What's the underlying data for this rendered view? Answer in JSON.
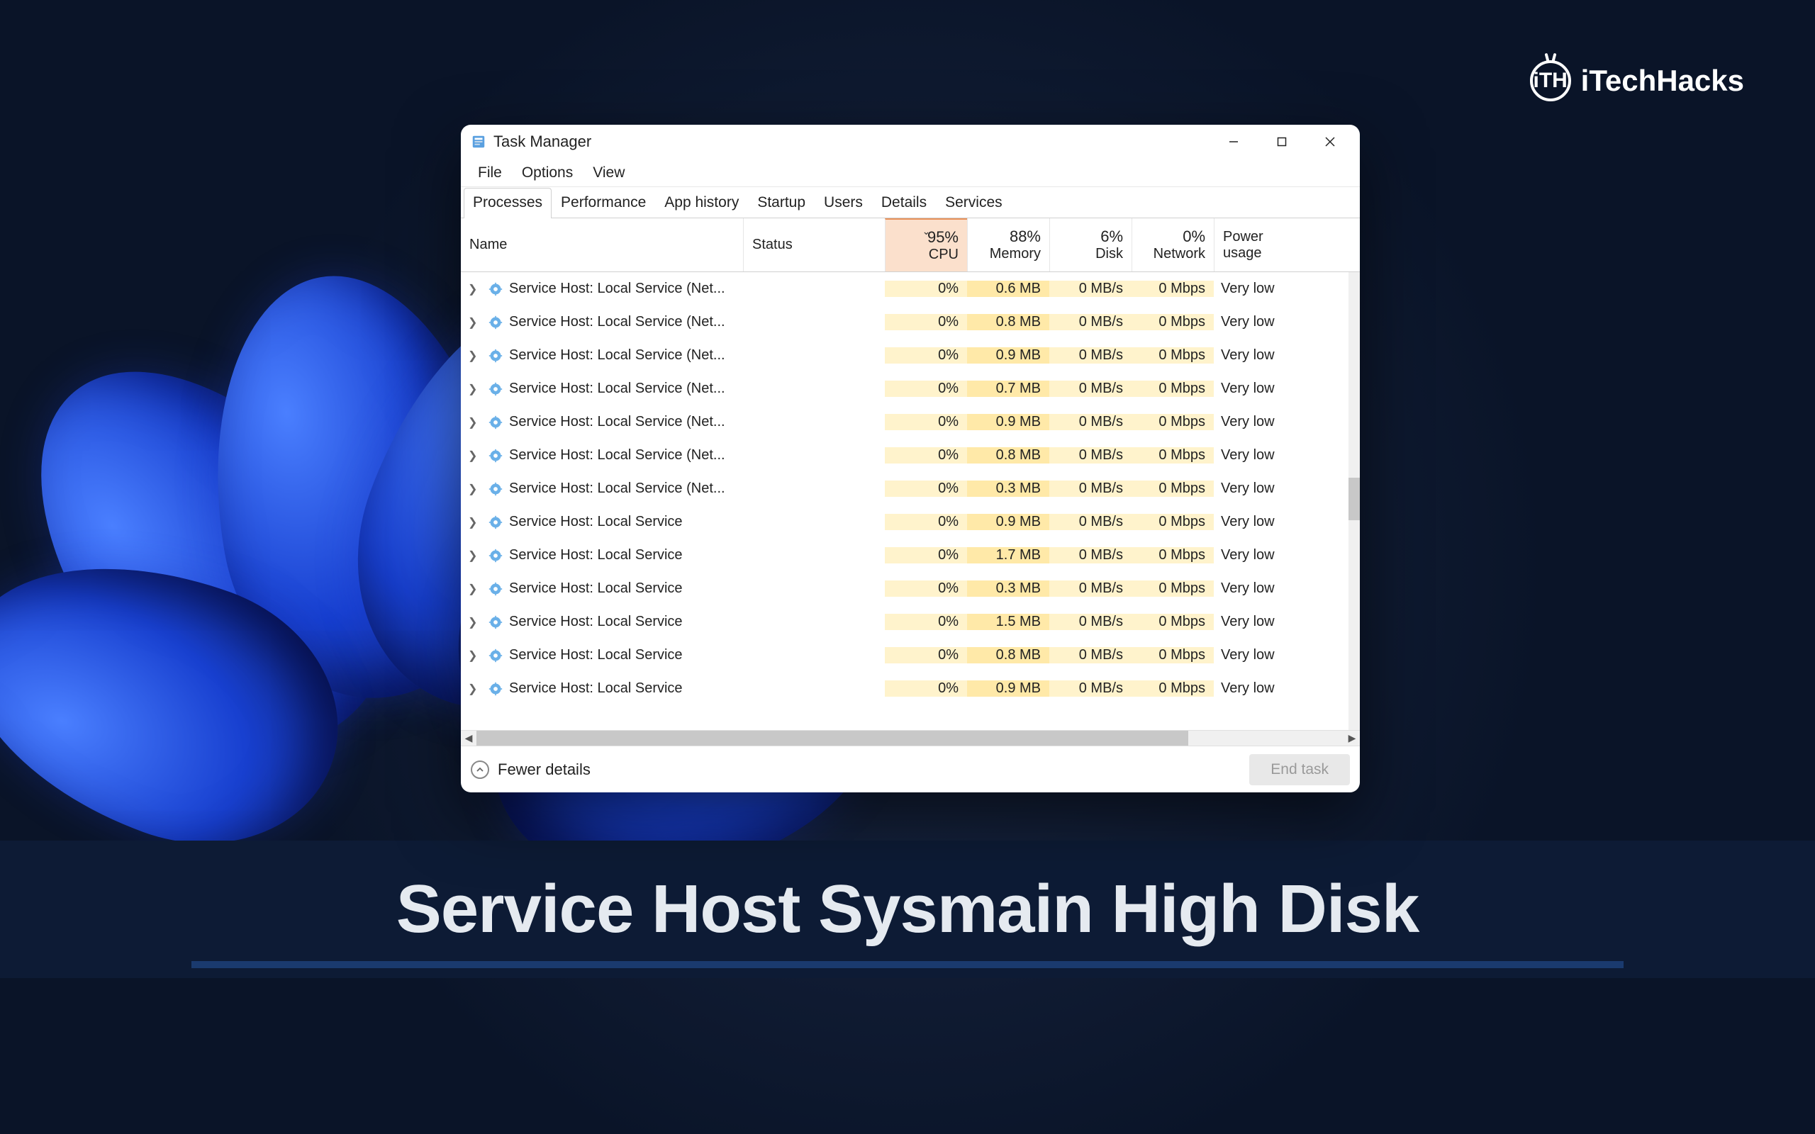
{
  "brand": {
    "name": "iTechHacks",
    "mark": "iTH"
  },
  "caption": "Service Host Sysmain High Disk",
  "window": {
    "title": "Task Manager",
    "menu": [
      "File",
      "Options",
      "View"
    ],
    "tabs": [
      "Processes",
      "Performance",
      "App history",
      "Startup",
      "Users",
      "Details",
      "Services"
    ],
    "active_tab": 0,
    "columns": {
      "name": "Name",
      "status": "Status",
      "cpu": {
        "pct": "95%",
        "label": "CPU"
      },
      "memory": {
        "pct": "88%",
        "label": "Memory"
      },
      "disk": {
        "pct": "6%",
        "label": "Disk"
      },
      "network": {
        "pct": "0%",
        "label": "Network"
      },
      "power": {
        "label": "Power usage"
      }
    },
    "rows": [
      {
        "name": "Service Host: Local Service (Net...",
        "cpu": "0%",
        "mem": "0.6 MB",
        "disk": "0 MB/s",
        "net": "0 Mbps",
        "power": "Very low"
      },
      {
        "name": "Service Host: Local Service (Net...",
        "cpu": "0%",
        "mem": "0.8 MB",
        "disk": "0 MB/s",
        "net": "0 Mbps",
        "power": "Very low"
      },
      {
        "name": "Service Host: Local Service (Net...",
        "cpu": "0%",
        "mem": "0.9 MB",
        "disk": "0 MB/s",
        "net": "0 Mbps",
        "power": "Very low"
      },
      {
        "name": "Service Host: Local Service (Net...",
        "cpu": "0%",
        "mem": "0.7 MB",
        "disk": "0 MB/s",
        "net": "0 Mbps",
        "power": "Very low"
      },
      {
        "name": "Service Host: Local Service (Net...",
        "cpu": "0%",
        "mem": "0.9 MB",
        "disk": "0 MB/s",
        "net": "0 Mbps",
        "power": "Very low"
      },
      {
        "name": "Service Host: Local Service (Net...",
        "cpu": "0%",
        "mem": "0.8 MB",
        "disk": "0 MB/s",
        "net": "0 Mbps",
        "power": "Very low"
      },
      {
        "name": "Service Host: Local Service (Net...",
        "cpu": "0%",
        "mem": "0.3 MB",
        "disk": "0 MB/s",
        "net": "0 Mbps",
        "power": "Very low"
      },
      {
        "name": "Service Host: Local Service",
        "cpu": "0%",
        "mem": "0.9 MB",
        "disk": "0 MB/s",
        "net": "0 Mbps",
        "power": "Very low"
      },
      {
        "name": "Service Host: Local Service",
        "cpu": "0%",
        "mem": "1.7 MB",
        "disk": "0 MB/s",
        "net": "0 Mbps",
        "power": "Very low"
      },
      {
        "name": "Service Host: Local Service",
        "cpu": "0%",
        "mem": "0.3 MB",
        "disk": "0 MB/s",
        "net": "0 Mbps",
        "power": "Very low"
      },
      {
        "name": "Service Host: Local Service",
        "cpu": "0%",
        "mem": "1.5 MB",
        "disk": "0 MB/s",
        "net": "0 Mbps",
        "power": "Very low"
      },
      {
        "name": "Service Host: Local Service",
        "cpu": "0%",
        "mem": "0.8 MB",
        "disk": "0 MB/s",
        "net": "0 Mbps",
        "power": "Very low"
      },
      {
        "name": "Service Host: Local Service",
        "cpu": "0%",
        "mem": "0.9 MB",
        "disk": "0 MB/s",
        "net": "0 Mbps",
        "power": "Very low"
      }
    ],
    "footer": {
      "fewer": "Fewer details",
      "end_task": "End task"
    }
  }
}
